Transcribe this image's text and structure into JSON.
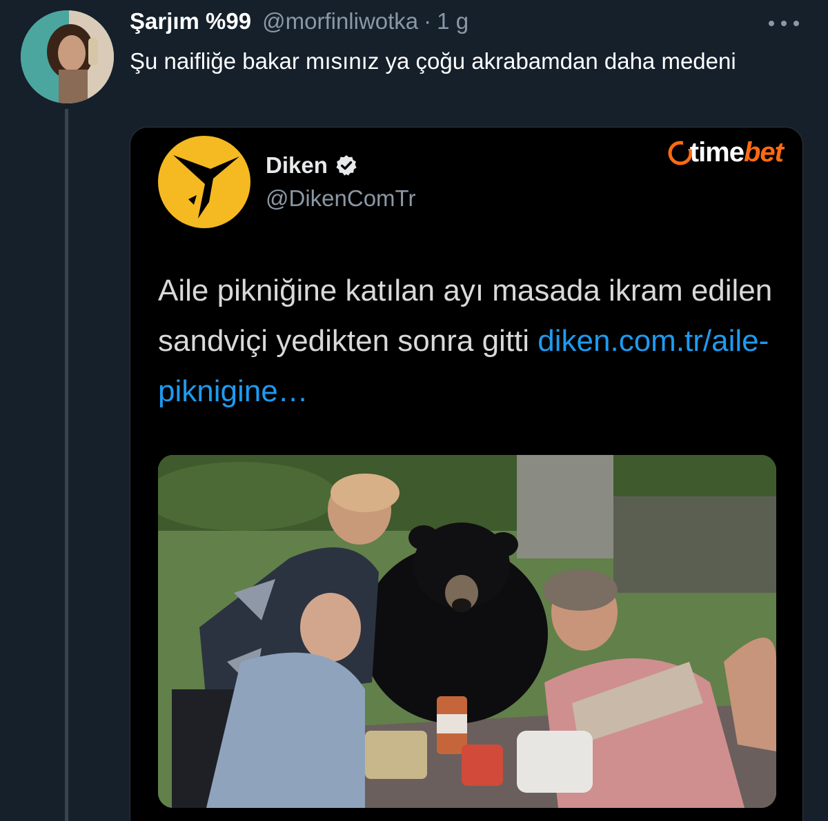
{
  "tweet": {
    "display_name": "Şarjım %99",
    "handle": "@morfinliwotka",
    "separator": "·",
    "time": "1 g",
    "text": "Şu naifliğe bakar mısınız ya çoğu akrabamdan daha medeni"
  },
  "quoted": {
    "name": "Diken",
    "handle": "@DikenComTr",
    "text": "Aile pikniğine katılan ayı masada ikram edilen sandviçi yedikten sonra gitti",
    "link": "diken.com.tr/aile-piknigine…",
    "watermark_a": "time",
    "watermark_b": "bet"
  },
  "icons": {
    "more": "more-horizontal-icon",
    "verified": "verified-badge-icon"
  },
  "colors": {
    "background": "#15202b",
    "link": "#1d9bf0",
    "diken_brand": "#f5b921",
    "watermark_accent": "#ff6a13"
  }
}
